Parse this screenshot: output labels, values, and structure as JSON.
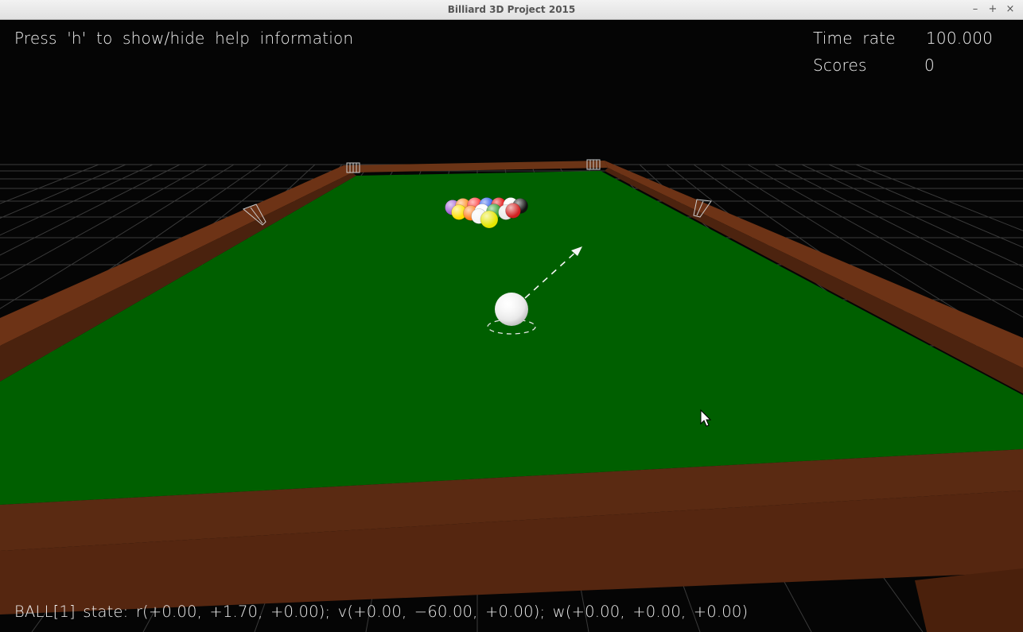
{
  "window": {
    "title": "Billiard 3D Project 2015",
    "minimize_glyph": "–",
    "maximize_glyph": "+",
    "close_glyph": "×"
  },
  "hud": {
    "help_text": "Press 'h' to show/hide help information",
    "time_rate_label": "Time rate",
    "time_rate_value": "100.000",
    "scores_label": "Scores",
    "scores_value": "0",
    "ball_state_text": "BALL[1] state: r(+0.00, +1.70, +0.00); v(+0.00, −60.00, +0.00); w(+0.00, +0.00, +0.00)"
  },
  "colors": {
    "felt": "#005f00",
    "rail_wood": "#5c2a12",
    "rail_dark": "#44200d",
    "grid": "#3a3a3a",
    "cue_ball": "#ffffff",
    "text": "#f0f0f0"
  },
  "cue_ball": {
    "name": "cue-ball"
  },
  "racked_balls": [
    {
      "color": "#a05fd6"
    },
    {
      "color": "#ff8a1e"
    },
    {
      "color": "#ff3030"
    },
    {
      "color": "#2255ee"
    },
    {
      "color": "#e00000"
    },
    {
      "color": "#ffffff"
    },
    {
      "color": "#111111"
    },
    {
      "color": "#ffe000"
    },
    {
      "color": "#ff7f1f"
    },
    {
      "color": "#ffffff"
    },
    {
      "color": "#2a9a2a"
    },
    {
      "color": "#e8e8e8"
    },
    {
      "color": "#d02020"
    },
    {
      "color": "#f5f5f5"
    },
    {
      "color": "#e6e600"
    }
  ]
}
